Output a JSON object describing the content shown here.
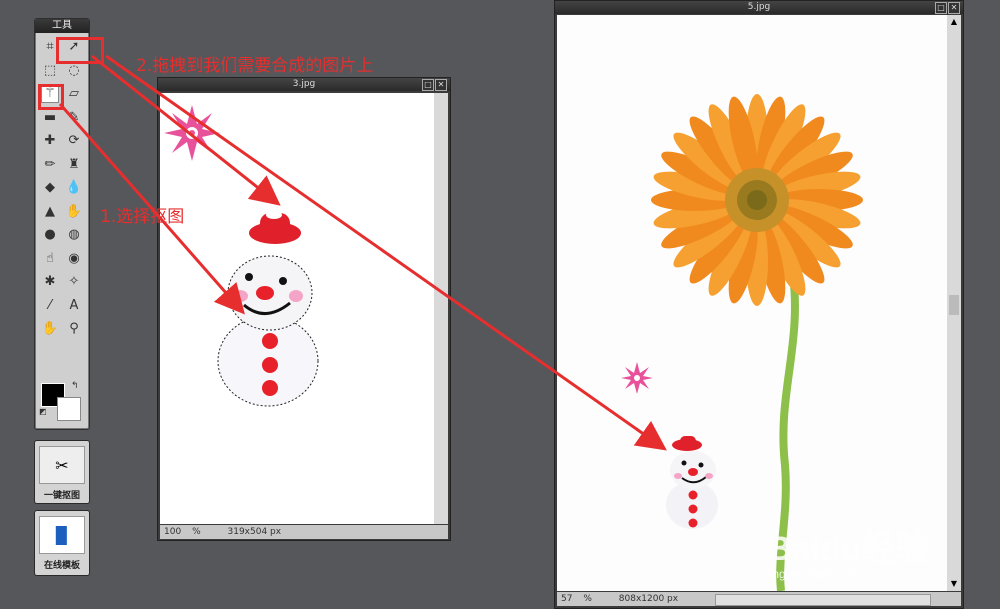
{
  "toolbox": {
    "title": "工具",
    "tools": [
      {
        "name": "crop-tool-icon",
        "glyph": "⌗"
      },
      {
        "name": "move-tool-icon",
        "glyph": "➚"
      },
      {
        "name": "marquee-tool-icon",
        "glyph": "⬚"
      },
      {
        "name": "lasso-tool-icon",
        "glyph": "◌"
      },
      {
        "name": "magic-wand-tool-icon",
        "glyph": "⚚"
      },
      {
        "name": "eraser-tool-icon",
        "glyph": "▱"
      },
      {
        "name": "gradient-tool-icon",
        "glyph": "▬"
      },
      {
        "name": "brush-tool-icon",
        "glyph": "✎"
      },
      {
        "name": "healing-tool-icon",
        "glyph": "✚"
      },
      {
        "name": "replace-color-tool-icon",
        "glyph": "⟳"
      },
      {
        "name": "pencil-tool-icon",
        "glyph": "✏"
      },
      {
        "name": "stamp-tool-icon",
        "glyph": "♜"
      },
      {
        "name": "shape-tool-icon",
        "glyph": "◆"
      },
      {
        "name": "blur-tool-icon",
        "glyph": "💧"
      },
      {
        "name": "sharpen-tool-icon",
        "glyph": "▲"
      },
      {
        "name": "dodge-tool-icon",
        "glyph": "✋"
      },
      {
        "name": "burn-tool-icon",
        "glyph": "●"
      },
      {
        "name": "sponge-tool-icon",
        "glyph": "◍"
      },
      {
        "name": "smudge-tool-icon",
        "glyph": "☝"
      },
      {
        "name": "redeye-tool-icon",
        "glyph": "◉"
      },
      {
        "name": "bloat-tool-icon",
        "glyph": "✱"
      },
      {
        "name": "pinch-tool-icon",
        "glyph": "✧"
      },
      {
        "name": "color-picker-tool-icon",
        "glyph": "⁄"
      },
      {
        "name": "text-tool-icon",
        "glyph": "A"
      },
      {
        "name": "hand-tool-icon",
        "glyph": "✋"
      },
      {
        "name": "zoom-tool-icon",
        "glyph": "⚲"
      }
    ],
    "colors": {
      "foreground": "#000000",
      "background": "#ffffff"
    }
  },
  "panel_buttons": [
    {
      "label": "一键抠图"
    },
    {
      "label": "在线模板"
    }
  ],
  "window_small": {
    "title": "3.jpg",
    "zoom": "100",
    "zoom_unit": "%",
    "dimensions": "319x504 px"
  },
  "window_large": {
    "title": "5.jpg",
    "zoom": "57",
    "zoom_unit": "%",
    "dimensions": "808x1200 px"
  },
  "annotations": {
    "step1": "1.选择抠图",
    "step2": "2.拖拽到我们需要合成的图片上"
  },
  "watermark": {
    "brand": "Baidu经验",
    "url": "jingyan.baidu.com"
  },
  "colors": {
    "annotation_red": "#e62e2e",
    "flower_orange": "#f08a1e",
    "stem_green": "#8dc04a"
  }
}
